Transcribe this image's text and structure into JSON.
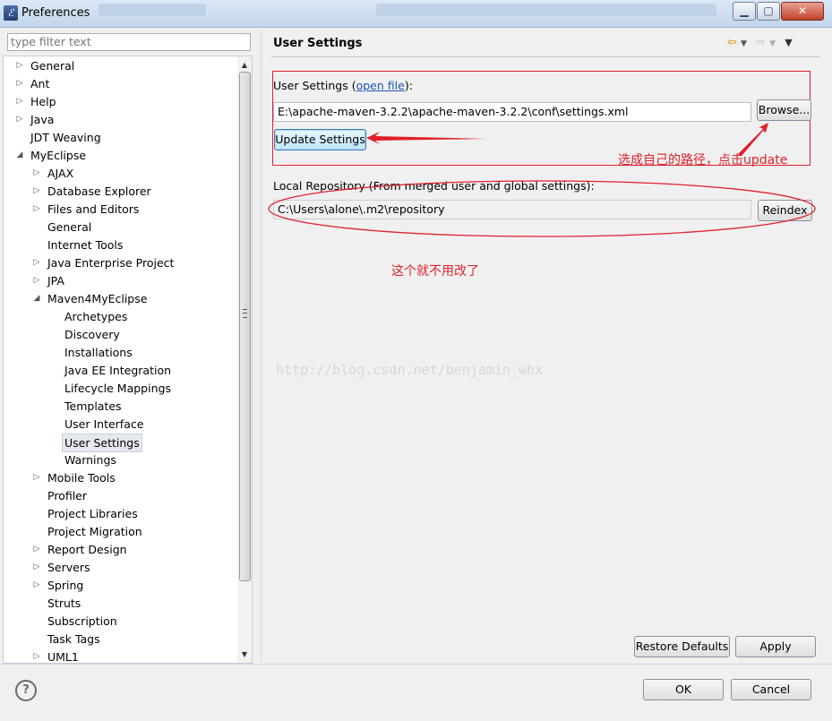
{
  "window": {
    "title": "Preferences"
  },
  "filter": {
    "placeholder": "type filter text"
  },
  "tree": {
    "items": [
      {
        "label": "General",
        "indent": 0,
        "arrow": "right"
      },
      {
        "label": "Ant",
        "indent": 0,
        "arrow": "right"
      },
      {
        "label": "Help",
        "indent": 0,
        "arrow": "right"
      },
      {
        "label": "Java",
        "indent": 0,
        "arrow": "right"
      },
      {
        "label": "JDT Weaving",
        "indent": 0,
        "arrow": ""
      },
      {
        "label": "MyEclipse",
        "indent": 0,
        "arrow": "down"
      },
      {
        "label": "AJAX",
        "indent": 1,
        "arrow": "right"
      },
      {
        "label": "Database Explorer",
        "indent": 1,
        "arrow": "right"
      },
      {
        "label": "Files and Editors",
        "indent": 1,
        "arrow": "right"
      },
      {
        "label": "General",
        "indent": 1,
        "arrow": ""
      },
      {
        "label": "Internet Tools",
        "indent": 1,
        "arrow": ""
      },
      {
        "label": "Java Enterprise Project",
        "indent": 1,
        "arrow": "right"
      },
      {
        "label": "JPA",
        "indent": 1,
        "arrow": "right"
      },
      {
        "label": "Maven4MyEclipse",
        "indent": 1,
        "arrow": "down"
      },
      {
        "label": "Archetypes",
        "indent": 2,
        "arrow": ""
      },
      {
        "label": "Discovery",
        "indent": 2,
        "arrow": ""
      },
      {
        "label": "Installations",
        "indent": 2,
        "arrow": ""
      },
      {
        "label": "Java EE Integration",
        "indent": 2,
        "arrow": ""
      },
      {
        "label": "Lifecycle Mappings",
        "indent": 2,
        "arrow": ""
      },
      {
        "label": "Templates",
        "indent": 2,
        "arrow": ""
      },
      {
        "label": "User Interface",
        "indent": 2,
        "arrow": ""
      },
      {
        "label": "User Settings",
        "indent": 2,
        "arrow": "",
        "selected": true
      },
      {
        "label": "Warnings",
        "indent": 2,
        "arrow": ""
      },
      {
        "label": "Mobile Tools",
        "indent": 1,
        "arrow": "right"
      },
      {
        "label": "Profiler",
        "indent": 1,
        "arrow": ""
      },
      {
        "label": "Project Libraries",
        "indent": 1,
        "arrow": ""
      },
      {
        "label": "Project Migration",
        "indent": 1,
        "arrow": ""
      },
      {
        "label": "Report Design",
        "indent": 1,
        "arrow": "right"
      },
      {
        "label": "Servers",
        "indent": 1,
        "arrow": "right"
      },
      {
        "label": "Spring",
        "indent": 1,
        "arrow": "right"
      },
      {
        "label": "Struts",
        "indent": 1,
        "arrow": ""
      },
      {
        "label": "Subscription",
        "indent": 1,
        "arrow": ""
      },
      {
        "label": "Task Tags",
        "indent": 1,
        "arrow": ""
      },
      {
        "label": "UML1",
        "indent": 1,
        "arrow": "right"
      }
    ]
  },
  "page": {
    "title": "User Settings",
    "user_settings_label": "User Settings (",
    "open_file_link": "open file",
    "user_settings_suffix": "):",
    "settings_path": "E:\\apache-maven-3.2.2\\apache-maven-3.2.2\\conf\\settings.xml",
    "browse_label": "Browse...",
    "update_label": "Update Settings",
    "local_repo_label": "Local Repository (From merged user and global settings):",
    "local_repo_path": "C:\\Users\\alone\\.m2\\repository",
    "reindex_label": "Reindex",
    "restore_defaults_label": "Restore Defaults",
    "apply_label": "Apply"
  },
  "annotations": {
    "choose_path": "选成自己的路径，点击update",
    "no_change": "这个就不用改了",
    "watermark": "http://blog.csdn.net/benjamin_whx",
    "color": "#e0202a"
  },
  "footer": {
    "ok_label": "OK",
    "cancel_label": "Cancel",
    "help_symbol": "?"
  },
  "icons": {
    "app": "eclipse-icon",
    "back": "back-arrow-icon",
    "forward": "forward-arrow-icon",
    "menu": "view-menu-icon",
    "help": "help-icon"
  }
}
